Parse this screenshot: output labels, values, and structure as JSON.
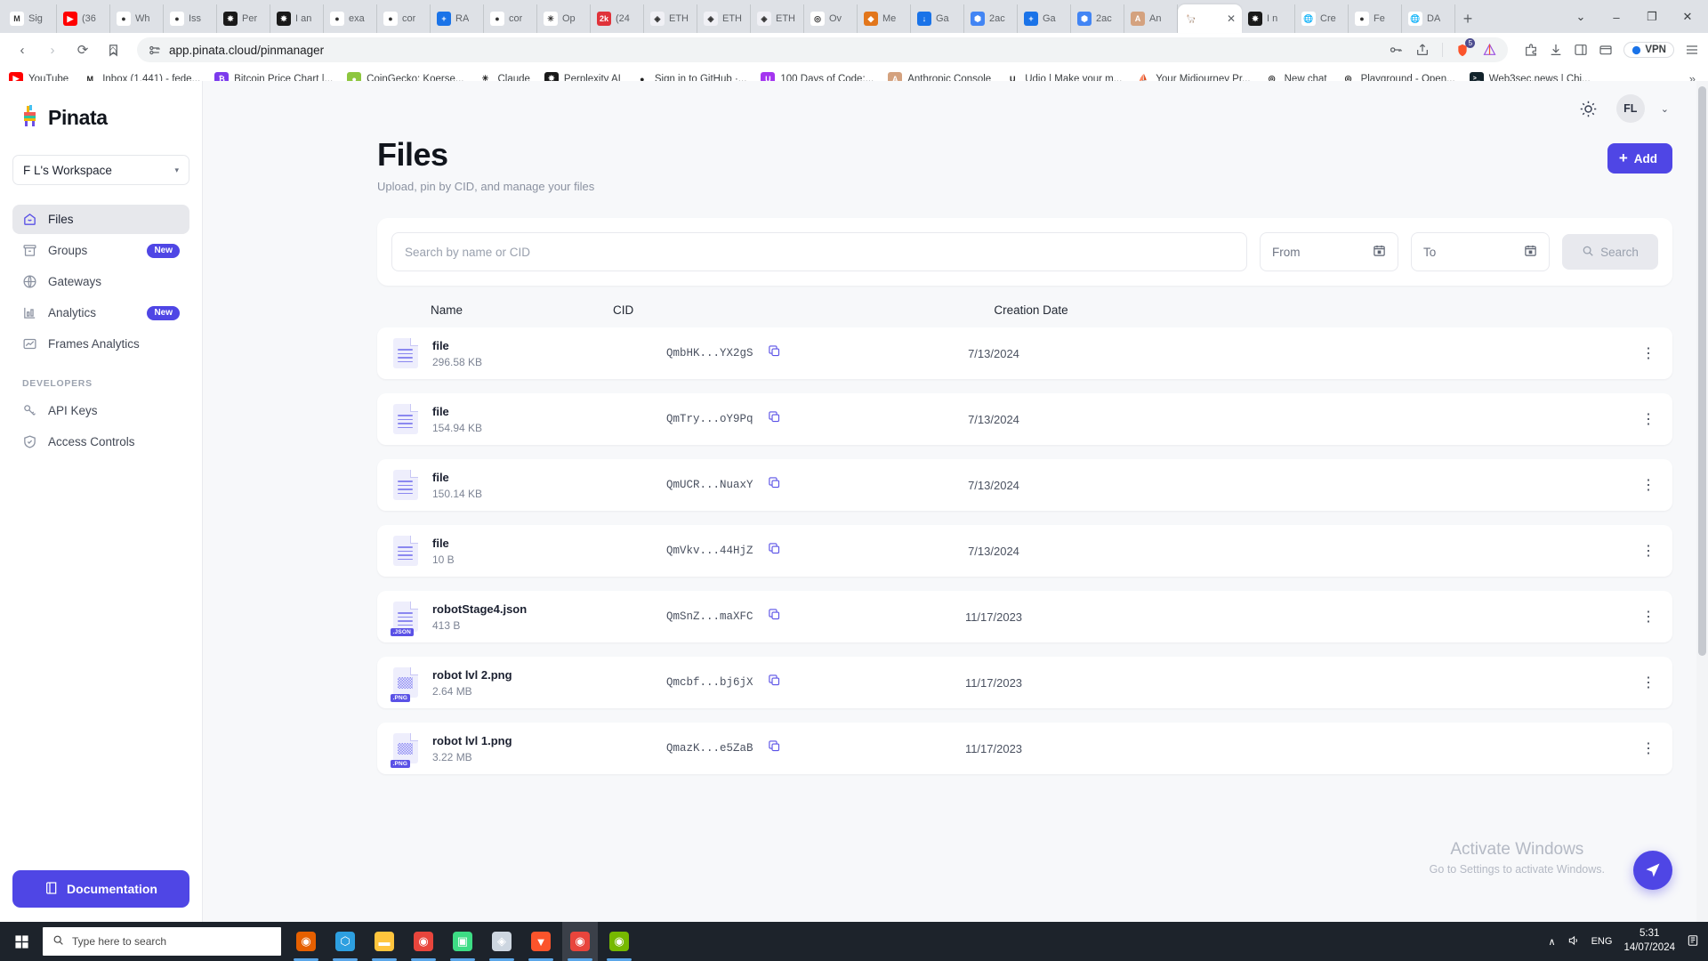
{
  "browser": {
    "tabs": [
      {
        "label": "Sig",
        "icon": "gmail",
        "color": "#ffffff",
        "glyph": "M"
      },
      {
        "label": "(36",
        "icon": "youtube",
        "color": "#ff0000",
        "glyph": "▶"
      },
      {
        "label": "Wh",
        "icon": "github",
        "color": "#ffffff",
        "glyph": "●"
      },
      {
        "label": "Iss",
        "icon": "github",
        "color": "#ffffff",
        "glyph": "●"
      },
      {
        "label": "Per",
        "icon": "perplexity",
        "color": "#1a1a1a",
        "glyph": "✸"
      },
      {
        "label": "I an",
        "icon": "perplexity",
        "color": "#1a1a1a",
        "glyph": "✸"
      },
      {
        "label": "exa",
        "icon": "github",
        "color": "#ffffff",
        "glyph": "●"
      },
      {
        "label": "cor",
        "icon": "github",
        "color": "#ffffff",
        "glyph": "●"
      },
      {
        "label": "RA",
        "icon": "bluesquare",
        "color": "#1a73e8",
        "glyph": "+"
      },
      {
        "label": "cor",
        "icon": "github",
        "color": "#ffffff",
        "glyph": "●"
      },
      {
        "label": "Op",
        "icon": "claude",
        "color": "#ffffff",
        "glyph": "✳"
      },
      {
        "label": "(24",
        "icon": "redbadge",
        "color": "#e0333a",
        "glyph": "2k"
      },
      {
        "label": "ETH",
        "icon": "etherscan",
        "color": "#f0f0f5",
        "glyph": "◈"
      },
      {
        "label": "ETH",
        "icon": "etherscan",
        "color": "#f0f0f5",
        "glyph": "◈"
      },
      {
        "label": "ETH",
        "icon": "etherscan",
        "color": "#f0f0f5",
        "glyph": "◈"
      },
      {
        "label": "Ov",
        "icon": "openai",
        "color": "#ffffff",
        "glyph": "◎"
      },
      {
        "label": "Me",
        "icon": "metamask",
        "color": "#e2761b",
        "glyph": "◆"
      },
      {
        "label": "Ga",
        "icon": "download",
        "color": "#1a73e8",
        "glyph": "↓"
      },
      {
        "label": "2ac",
        "icon": "bluehex",
        "color": "#4285f4",
        "glyph": "⬢"
      },
      {
        "label": "Ga",
        "icon": "bluesquare",
        "color": "#1a73e8",
        "glyph": "+"
      },
      {
        "label": "2ac",
        "icon": "bluehex",
        "color": "#4285f4",
        "glyph": "⬢"
      },
      {
        "label": "An",
        "icon": "anthropic",
        "color": "#d4a27f",
        "glyph": "A"
      },
      {
        "label": "",
        "icon": "pinata",
        "color": "#ffffff",
        "glyph": "🦙",
        "active": true
      },
      {
        "label": "I n",
        "icon": "perplexity",
        "color": "#1a1a1a",
        "glyph": "✸"
      },
      {
        "label": "Cre",
        "icon": "globe",
        "color": "#ffffff",
        "glyph": "🌐"
      },
      {
        "label": "Fe",
        "icon": "github",
        "color": "#ffffff",
        "glyph": "●"
      },
      {
        "label": "DA",
        "icon": "globe",
        "color": "#ffffff",
        "glyph": "🌐"
      }
    ],
    "new_tab_label": "+",
    "window_controls": [
      "⌄",
      "–",
      "❐",
      "✕"
    ],
    "nav": {
      "back": "‹",
      "forward": "›",
      "reload": "⟳",
      "home": "⌂",
      "url": "app.pinata.cloud/pinmanager",
      "bookmark_icon": "☐",
      "permissions_icon": "⚷",
      "password_icon": "⚷",
      "share_icon": "↗",
      "brave_shield_count": "5",
      "vpn_label": "VPN",
      "menu_icon": "☰",
      "extension_icon": "⧉",
      "download_icon": "↓",
      "sidepanel_icon": "◫",
      "wallet_icon": "▤"
    },
    "bookmarks": [
      {
        "label": "YouTube",
        "color": "#ff0000",
        "glyph": "▶"
      },
      {
        "label": "Inbox (1.441) - fede...",
        "color": "#ffffff",
        "glyph": "M"
      },
      {
        "label": "Bitcoin Price Chart |...",
        "color": "#7c3aed",
        "glyph": "₿"
      },
      {
        "label": "CoinGecko: Koerse...",
        "color": "#8dc63f",
        "glyph": "●"
      },
      {
        "label": "Claude",
        "color": "#ffffff",
        "glyph": "✳"
      },
      {
        "label": "Perplexity AI",
        "color": "#1a1a1a",
        "glyph": "✸"
      },
      {
        "label": "Sign in to GitHub ·...",
        "color": "#ffffff",
        "glyph": "●"
      },
      {
        "label": "100 Days of Code:...",
        "color": "#a435f0",
        "glyph": "U"
      },
      {
        "label": "Anthropic Console",
        "color": "#d4a27f",
        "glyph": "A"
      },
      {
        "label": "Udio | Make your m...",
        "color": "#ffffff",
        "glyph": "U"
      },
      {
        "label": "Your Midjourney Pr...",
        "color": "#ffffff",
        "glyph": "⛵"
      },
      {
        "label": "New chat",
        "color": "#ffffff",
        "glyph": "◎"
      },
      {
        "label": "Playground - Open...",
        "color": "#ffffff",
        "glyph": "◎"
      },
      {
        "label": "Web3sec.news | Chi...",
        "color": "#12232b",
        "glyph": ">_"
      }
    ],
    "bookmarks_overflow": "»"
  },
  "sidebar": {
    "brand": "Pinata",
    "workspace": "F L's Workspace",
    "workspace_chevron": "▾",
    "items": [
      {
        "label": "Files",
        "icon": "home-icon",
        "active": true,
        "badge": ""
      },
      {
        "label": "Groups",
        "icon": "box-icon",
        "active": false,
        "badge": "New"
      },
      {
        "label": "Gateways",
        "icon": "globe-icon",
        "active": false,
        "badge": ""
      },
      {
        "label": "Analytics",
        "icon": "bar-chart-icon",
        "active": false,
        "badge": "New"
      },
      {
        "label": "Frames Analytics",
        "icon": "frame-chart-icon",
        "active": false,
        "badge": ""
      }
    ],
    "developers_label": "DEVELOPERS",
    "developer_items": [
      {
        "label": "API Keys",
        "icon": "key-icon"
      },
      {
        "label": "Access Controls",
        "icon": "shield-check-icon"
      }
    ],
    "documentation_label": "Documentation"
  },
  "topbar": {
    "theme_icon": "sun-icon",
    "avatar_initials": "FL",
    "avatar_chevron": "⌄"
  },
  "main": {
    "title": "Files",
    "subtitle": "Upload, pin by CID, and manage your files",
    "add_button": "Add",
    "add_plus": "+",
    "search_placeholder": "Search by name or CID",
    "from_placeholder": "From",
    "to_placeholder": "To",
    "search_button": "Search",
    "columns": {
      "name": "Name",
      "cid": "CID",
      "date": "Creation Date"
    },
    "rows": [
      {
        "name": "file",
        "size": "296.58 KB",
        "cid": "QmbHK...YX2gS",
        "date": "7/13/2024",
        "ext": ""
      },
      {
        "name": "file",
        "size": "154.94 KB",
        "cid": "QmTry...oY9Pq",
        "date": "7/13/2024",
        "ext": ""
      },
      {
        "name": "file",
        "size": "150.14 KB",
        "cid": "QmUCR...NuaxY",
        "date": "7/13/2024",
        "ext": ""
      },
      {
        "name": "file",
        "size": "10 B",
        "cid": "QmVkv...44HjZ",
        "date": "7/13/2024",
        "ext": ""
      },
      {
        "name": "robotStage4.json",
        "size": "413 B",
        "cid": "QmSnZ...maXFC",
        "date": "11/17/2023",
        "ext": ".JSON"
      },
      {
        "name": "robot lvl 2.png",
        "size": "2.64 MB",
        "cid": "Qmcbf...bj6jX",
        "date": "11/17/2023",
        "ext": ".PNG"
      },
      {
        "name": "robot lvl 1.png",
        "size": "3.22 MB",
        "cid": "QmazK...e5ZaB",
        "date": "11/17/2023",
        "ext": ".PNG"
      }
    ],
    "kebab": "⋮",
    "fab_icon": "✈"
  },
  "watermark": {
    "line1": "Activate Windows",
    "line2": "Go to Settings to activate Windows."
  },
  "taskbar": {
    "start_icon": "windows-icon",
    "search_placeholder": "Type here to search",
    "apps": [
      {
        "name": "firefox",
        "color": "#e66000",
        "glyph": "◉"
      },
      {
        "name": "vscode",
        "color": "#2d9fe0",
        "glyph": "⬡"
      },
      {
        "name": "file-explorer",
        "color": "#ffc53d",
        "glyph": "▬"
      },
      {
        "name": "chrome",
        "color": "#e8453c",
        "glyph": "◉"
      },
      {
        "name": "android-studio",
        "color": "#3ddc84",
        "glyph": "▣"
      },
      {
        "name": "unity",
        "color": "#cdd6e0",
        "glyph": "◈"
      },
      {
        "name": "brave",
        "color": "#fb542b",
        "glyph": "▼"
      },
      {
        "name": "chrome-active",
        "color": "#e8453c",
        "glyph": "◉"
      },
      {
        "name": "nvidia",
        "color": "#76b900",
        "glyph": "◉"
      }
    ],
    "tray_chevron": "∧",
    "volume_icon": "🔊",
    "language": "ENG",
    "time": "5:31",
    "date": "14/07/2024",
    "notification_icon": "🗔"
  },
  "colors": {
    "accent": "#4f46e5",
    "sidebar_bg": "#ffffff",
    "page_bg": "#f7f8fa",
    "taskbar_bg": "#1d232b"
  }
}
